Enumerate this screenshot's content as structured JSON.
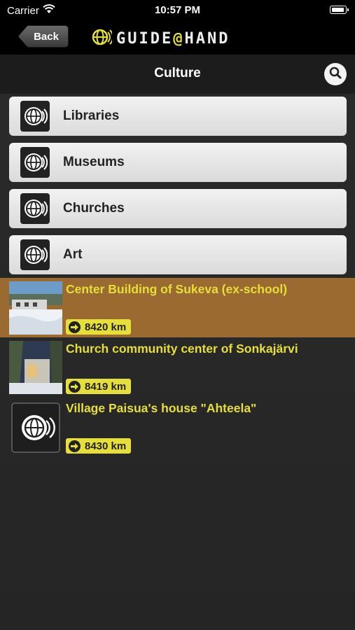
{
  "status_bar": {
    "carrier": "Carrier",
    "time": "10:57 PM"
  },
  "top_bar": {
    "back_label": "Back",
    "logo_text_before": "GUIDE",
    "logo_at": "@",
    "logo_text_after": "HAND"
  },
  "title_bar": {
    "title": "Culture"
  },
  "categories": [
    {
      "label": "Libraries",
      "icon": "guide-globe-icon"
    },
    {
      "label": "Museums",
      "icon": "guide-globe-icon"
    },
    {
      "label": "Churches",
      "icon": "guide-globe-icon"
    },
    {
      "label": "Art",
      "icon": "guide-globe-icon"
    }
  ],
  "places": [
    {
      "name": "Center Building of Sukeva (ex-school)",
      "distance": "8420 km",
      "thumbnail": "snow-building-photo",
      "highlighted": true
    },
    {
      "name": "Church community center of Sonkajärvi",
      "distance": "8419 km",
      "thumbnail": "church-building-photo",
      "highlighted": false
    },
    {
      "name": "Village Paisua's house \"Ahteela\"",
      "distance": "8430 km",
      "thumbnail": "guide-globe-icon",
      "highlighted": false
    }
  ],
  "colors": {
    "accent_yellow": "#e6df3a",
    "highlight_row": "#9a6a30",
    "background": "#2b2b2b"
  }
}
